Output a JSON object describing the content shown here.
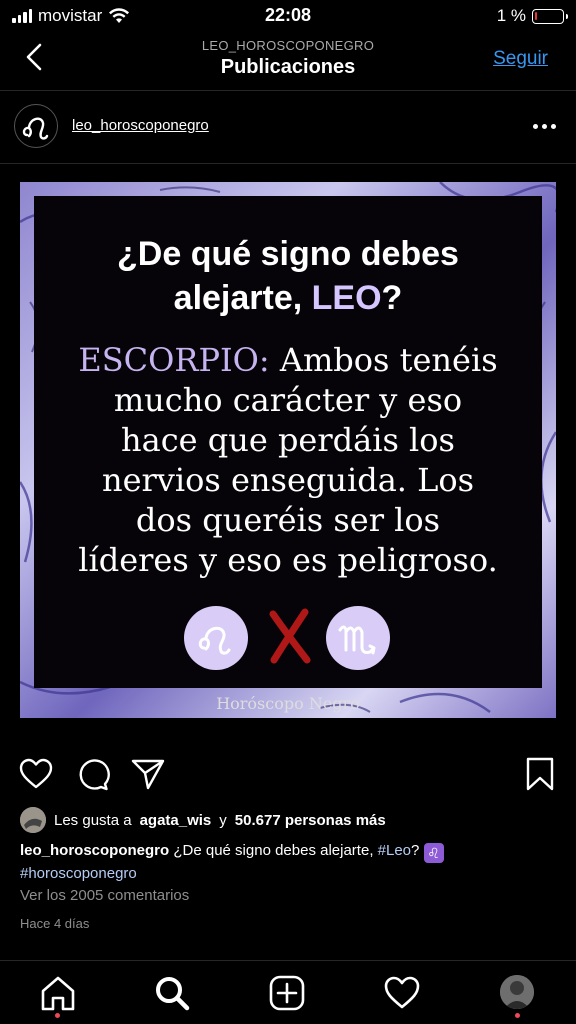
{
  "status_bar": {
    "carrier": "movistar",
    "time": "22:08",
    "battery_text": "1 %",
    "battery_level": 0.01
  },
  "nav": {
    "subtitle": "LEO_HOROSCOPONEGRO",
    "title": "Publicaciones",
    "follow_label": "Seguir"
  },
  "post": {
    "username": "leo_horoscoponegro",
    "image": {
      "title_line1": "¿De qué signo debes",
      "title_line2_prefix": "alejarte, ",
      "title_highlight": "LEO",
      "title_suffix": "?",
      "sign_label": "ESCORPIO:",
      "body_line1": " Ambos tenéis",
      "body_line2": "mucho carácter y eso",
      "body_line3": "hace que perdáis los",
      "body_line4": "nervios enseguida. Los",
      "body_line5": "dos queréis ser los",
      "body_line6": "líderes y eso es peligroso.",
      "leo_glyph": "♌",
      "scorpio_glyph": "♏",
      "credit": "Horóscopo Negro"
    },
    "likes": {
      "prefix": "Les gusta a",
      "first_user": "agata_wis",
      "connector": "y",
      "others": "50.677 personas más"
    },
    "caption": {
      "username": "leo_horoscoponegro",
      "text": " ¿De qué signo debes alejarte, ",
      "hashtag1": "#Leo",
      "after": "? ",
      "emoji": "♌",
      "hashtag2": "#horoscoponegro"
    },
    "comments_link": "Ver los 2005 comentarios",
    "time_ago": "Hace 4 días"
  },
  "icons": {
    "back": "chevron-left-icon",
    "more": "more-icon",
    "like": "heart-icon",
    "comment": "comment-icon",
    "share": "paper-plane-icon",
    "save": "bookmark-icon",
    "home": "home-icon",
    "search": "search-icon",
    "add": "add-icon",
    "activity": "heart-icon",
    "profile": "profile-avatar"
  },
  "colors": {
    "accent_link": "#3897f0",
    "highlight_purple": "#d6c6ff",
    "notification_dot": "#ed4956",
    "glyph_circle": "#d9ccf7",
    "cross_red": "#b01818"
  }
}
